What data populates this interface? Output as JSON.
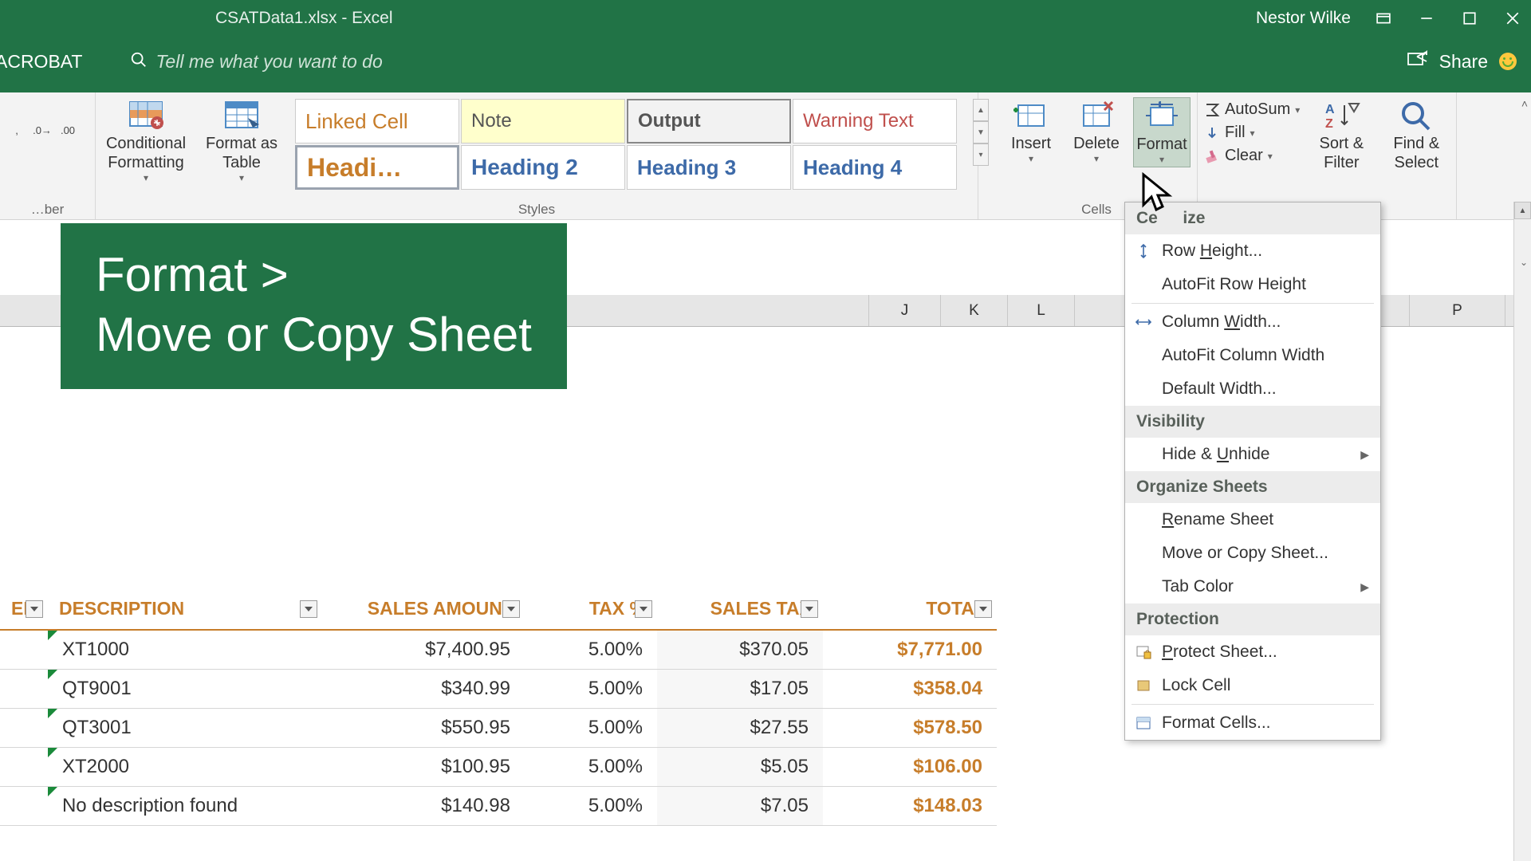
{
  "titlebar": {
    "title": "CSATData1.xlsx  -  Excel",
    "user": "Nestor Wilke"
  },
  "tabrow": {
    "acrobat": "ACROBAT",
    "tellme": "Tell me what you want to do",
    "share": "Share"
  },
  "ribbon": {
    "number_group": "…ber",
    "cond_fmt": "Conditional Formatting",
    "fmt_table": "Format as Table",
    "styles_label": "Styles",
    "styles": {
      "linked": "Linked Cell",
      "note": "Note",
      "output": "Output",
      "warning": "Warning Text",
      "h1": "Headi…",
      "h2": "Heading 2",
      "h3": "Heading 3",
      "h4": "Heading 4"
    },
    "cells_label": "Cells",
    "insert": "Insert",
    "delete": "Delete",
    "format": "Format",
    "autosum": "AutoSum",
    "fill": "Fill",
    "clear": "Clear",
    "sort": "Sort & Filter",
    "find": "Find & Select"
  },
  "callout": {
    "line1": "Format  >",
    "line2": "Move or Copy Sheet"
  },
  "columns": {
    "J": "J",
    "K": "K",
    "L": "L",
    "P": "P"
  },
  "table": {
    "headers": {
      "er": "ER",
      "desc": "DESCRIPTION",
      "amount": "SALES AMOUNT",
      "taxp": "TAX %",
      "tax": "SALES TAX",
      "total": "TOTAL"
    },
    "rows": [
      {
        "desc": "XT1000",
        "amount": "$7,400.95",
        "taxp": "5.00%",
        "tax": "$370.05",
        "total": "$7,771.00"
      },
      {
        "desc": "QT9001",
        "amount": "$340.99",
        "taxp": "5.00%",
        "tax": "$17.05",
        "total": "$358.04"
      },
      {
        "desc": "QT3001",
        "amount": "$550.95",
        "taxp": "5.00%",
        "tax": "$27.55",
        "total": "$578.50"
      },
      {
        "desc": "XT2000",
        "amount": "$100.95",
        "taxp": "5.00%",
        "tax": "$5.05",
        "total": "$106.00"
      },
      {
        "desc": "No description found",
        "amount": "$140.98",
        "taxp": "5.00%",
        "tax": "$7.05",
        "total": "$148.03"
      }
    ]
  },
  "format_menu": {
    "cell_size": "Cell Size",
    "row_height": "Row Height...",
    "autofit_row": "AutoFit Row Height",
    "col_width": "Column Width...",
    "autofit_col": "AutoFit Column Width",
    "default_width": "Default Width...",
    "visibility": "Visibility",
    "hide_unhide": "Hide & Unhide",
    "organize": "Organize Sheets",
    "rename": "Rename Sheet",
    "move_copy": "Move or Copy Sheet...",
    "tab_color": "Tab Color",
    "protection": "Protection",
    "protect_sheet": "Protect Sheet...",
    "lock_cell": "Lock Cell",
    "format_cells": "Format Cells..."
  }
}
